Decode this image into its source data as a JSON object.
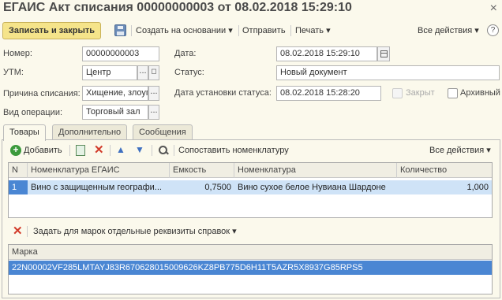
{
  "title": "ЕГАИС Акт списания 00000000003 от 08.02.2018 15:29:10",
  "toolbar": {
    "save_close": "Записать и закрыть",
    "create_based": "Создать на основании",
    "send": "Отправить",
    "print": "Печать",
    "all_actions": "Все действия",
    "help": "?"
  },
  "form": {
    "number_label": "Номер:",
    "number_value": "00000000003",
    "date_label": "Дата:",
    "date_value": "08.02.2018 15:29:10",
    "utm_label": "УТМ:",
    "utm_value": "Центр",
    "status_label": "Статус:",
    "status_value": "Новый документ",
    "reason_label": "Причина списания:",
    "reason_value": "Хищение, злоуп",
    "status_date_label": "Дата установки статуса:",
    "status_date_value": "08.02.2018 15:28:20",
    "closed_label": "Закрыт",
    "archive_label": "Архивный",
    "operation_label": "Вид операции:",
    "operation_value": "Торговый зал",
    "dots": "..."
  },
  "tabs": [
    "Товары",
    "Дополнительно",
    "Сообщения"
  ],
  "goods_toolbar": {
    "add": "Добавить",
    "match": "Сопоставить номенклатуру",
    "all_actions": "Все действия"
  },
  "goods_table": {
    "headers": [
      "N",
      "Номенклатура ЕГАИС",
      "Емкость",
      "Номенклатура",
      "Количество"
    ],
    "rows": [
      {
        "n": "1",
        "egais": "Вино с защищенным географи...",
        "capacity": "0,7500",
        "nomenclature": "Вино сухое белое Нувиана Шардоне",
        "quantity": "1,000"
      }
    ]
  },
  "marks_toolbar": {
    "set_details": "Задать для марок отдельные реквизиты справок"
  },
  "marks_table": {
    "header": "Марка",
    "rows": [
      "22N00002VF285LMTAYJ83R670628015009626KZ8PB775D6H11T5AZR5X8937G85RPS5"
    ]
  }
}
